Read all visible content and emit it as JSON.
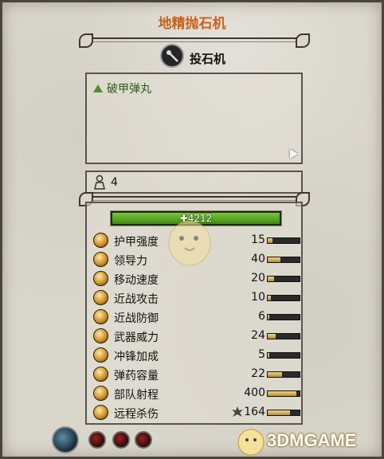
{
  "unit": {
    "title": "地精抛石机"
  },
  "weapon": {
    "name": "投石机",
    "icon": "catapult-icon"
  },
  "abilities": [
    {
      "label": "破甲弹丸",
      "icon": "green-triangle-icon"
    }
  ],
  "unit_count": {
    "icon": "soldier-icon",
    "value": "4"
  },
  "health": {
    "value": "4212",
    "icon": "plus-icon"
  },
  "stats": [
    {
      "label": "护甲强度",
      "value": "15",
      "fill": 0.15,
      "icon": "armor-icon"
    },
    {
      "label": "领导力",
      "value": "40",
      "fill": 0.4,
      "icon": "leadership-icon"
    },
    {
      "label": "移动速度",
      "value": "20",
      "fill": 0.2,
      "icon": "speed-icon"
    },
    {
      "label": "近战攻击",
      "value": "10",
      "fill": 0.1,
      "icon": "melee-attack-icon"
    },
    {
      "label": "近战防御",
      "value": "6",
      "fill": 0.06,
      "icon": "melee-defence-icon"
    },
    {
      "label": "武器威力",
      "value": "24",
      "fill": 0.24,
      "icon": "weapon-strength-icon"
    },
    {
      "label": "冲锋加成",
      "value": "5",
      "fill": 0.05,
      "icon": "charge-bonus-icon"
    },
    {
      "label": "弹药容量",
      "value": "22",
      "fill": 0.45,
      "icon": "ammunition-icon"
    },
    {
      "label": "部队射程",
      "value": "400",
      "fill": 0.9,
      "icon": "range-icon"
    },
    {
      "label": "远程杀伤",
      "value": "164",
      "fill": 0.7,
      "icon": "missile-damage-icon"
    }
  ],
  "watermark": {
    "text": "3DMGAME"
  },
  "colors": {
    "title": "#c8621c",
    "ability": "#2f5a1c",
    "health": "#5aa82a"
  }
}
